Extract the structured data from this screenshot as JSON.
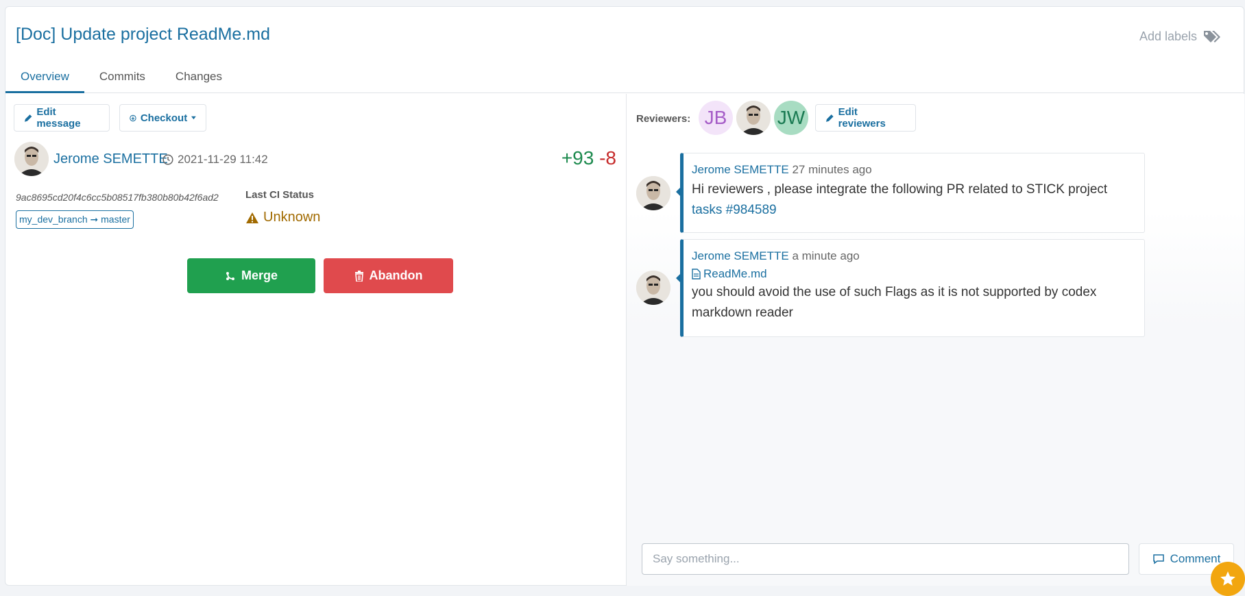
{
  "title": "[Doc] Update project ReadMe.md",
  "add_labels": "Add labels",
  "tabs": [
    {
      "label": "Overview"
    },
    {
      "label": "Commits"
    },
    {
      "label": "Changes"
    }
  ],
  "actions": {
    "edit_message": "Edit message",
    "checkout": "Checkout"
  },
  "author": {
    "name": "Jerome SEMETTE",
    "date": "2021-11-29 11:42"
  },
  "diff": {
    "added": "+93",
    "removed": "-8"
  },
  "commit_hash": "9ac8695cd20f4c6cc5b08517fb380b80b42f6ad2",
  "branch": {
    "source": "my_dev_branch",
    "target": "master"
  },
  "ci": {
    "label": "Last CI Status",
    "status": "Unknown"
  },
  "buttons": {
    "merge": "Merge",
    "abandon": "Abandon"
  },
  "reviewers": {
    "label": "Reviewers:",
    "list": [
      {
        "initials": "JB",
        "bg": "#f3e4f9",
        "fg": "#a55cc7"
      },
      {
        "initials": "",
        "photo": true
      },
      {
        "initials": "JW",
        "bg": "#a8dcc2",
        "fg": "#1a7a52"
      }
    ],
    "edit": "Edit reviewers"
  },
  "comments": [
    {
      "author": "Jerome SEMETTE",
      "time": "27 minutes ago",
      "text": "Hi reviewers , please integrate the following PR related to STICK project",
      "link": "tasks #984589"
    },
    {
      "author": "Jerome SEMETTE",
      "time": "a minute ago",
      "file": "ReadMe.md",
      "text1": "you should avoid the use of such Flags as it is not supported by codex",
      "text2": "markdown reader"
    }
  ],
  "comment_input": {
    "placeholder": "Say something..."
  },
  "comment_button": "Comment",
  "colors": {
    "accent": "#1a6fa0",
    "merge": "#20a04f",
    "abandon": "#e04a4d",
    "warning": "#a16a00",
    "fab": "#f2a60f"
  }
}
